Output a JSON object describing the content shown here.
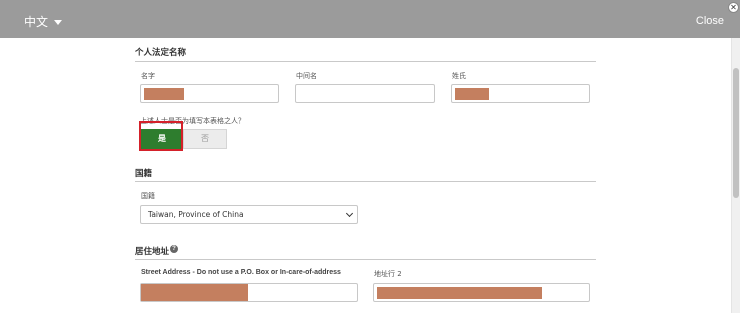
{
  "header": {
    "language": "中文",
    "close_label": "Close",
    "close_x": "✕"
  },
  "legal_name": {
    "section_title": "个人法定名称",
    "first_name_label": "名字",
    "middle_name_label": "中间名",
    "last_name_label": "姓氏",
    "question_label": "上述人士是否为填写本表格之人？",
    "yes_label": "是",
    "no_label": "否"
  },
  "nationality": {
    "section_title": "国籍",
    "field_label": "国籍",
    "selected_value": "Taiwan, Province of China"
  },
  "address": {
    "section_title": "居住地址",
    "help_icon": "?",
    "street_label": "Street Address - Do not use a P.O. Box or In-care-of-address",
    "line2_label": "地址行 2"
  },
  "colors": {
    "header_bg": "#9b9b9b",
    "yes_green": "#2e7d2e",
    "highlight_red": "#d4212a",
    "redaction": "#c47f5f"
  }
}
